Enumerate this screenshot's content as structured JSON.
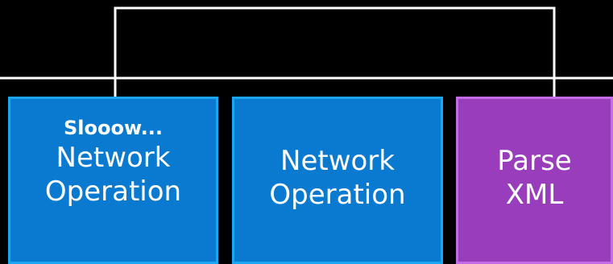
{
  "colors": {
    "background": "#000000",
    "line": "#ffffff",
    "network_fill": "#0a7ad0",
    "network_border": "#1aa6f0",
    "parse_fill": "#9a3dbd",
    "parse_border": "#c36ce8"
  },
  "boxes": [
    {
      "note": "Slooow...",
      "line1": "Network",
      "line2": "Operation",
      "kind": "network"
    },
    {
      "line1": "Network",
      "line2": "Operation",
      "kind": "network"
    },
    {
      "line1": "Parse",
      "line2": "XML",
      "kind": "parse"
    }
  ]
}
